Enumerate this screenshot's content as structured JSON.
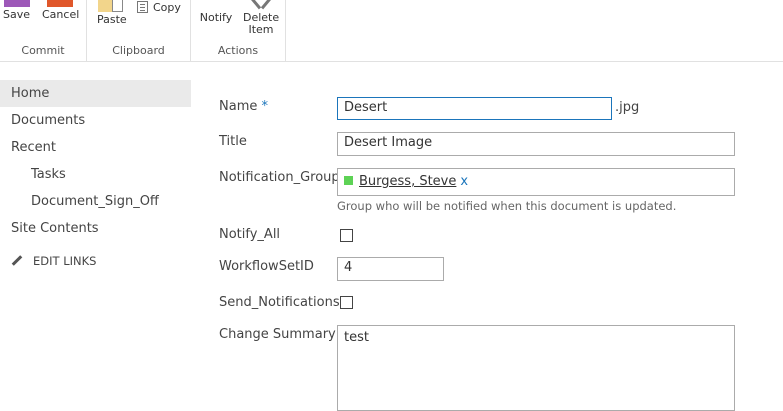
{
  "ribbon": {
    "commit": {
      "label": "Commit",
      "save": "Save",
      "cancel": "Cancel"
    },
    "clipboard": {
      "label": "Clipboard",
      "paste": "Paste",
      "copy": "Copy"
    },
    "actions": {
      "label": "Actions",
      "notify": "Notify",
      "delete_line1": "Delete",
      "delete_line2": "Item"
    }
  },
  "nav": {
    "items": [
      "Home",
      "Documents",
      "Recent",
      "Tasks",
      "Document_Sign_Off",
      "Site Contents"
    ],
    "edit_links": "EDIT LINKS"
  },
  "form": {
    "name": {
      "label": "Name",
      "required_mark": "*",
      "value": "Desert",
      "extension": ".jpg"
    },
    "title": {
      "label": "Title",
      "value": "Desert Image"
    },
    "notification_group": {
      "label": "Notification_Group",
      "person": "Burgess, Steve",
      "remove": "x",
      "help": "Group who will be notified when this document is updated."
    },
    "notify_all": {
      "label": "Notify_All",
      "checked": false
    },
    "workflow_set_id": {
      "label": "WorkflowSetID",
      "value": "4"
    },
    "send_notifications": {
      "label": "Send_Notifications",
      "checked": false
    },
    "change_summary": {
      "label": "Change Summary",
      "value": "test"
    }
  },
  "colors": {
    "accent": "#1b75bb",
    "presence": "#5dd255",
    "save_icon": "#9d58b8",
    "cancel_icon": "#e0572a"
  }
}
